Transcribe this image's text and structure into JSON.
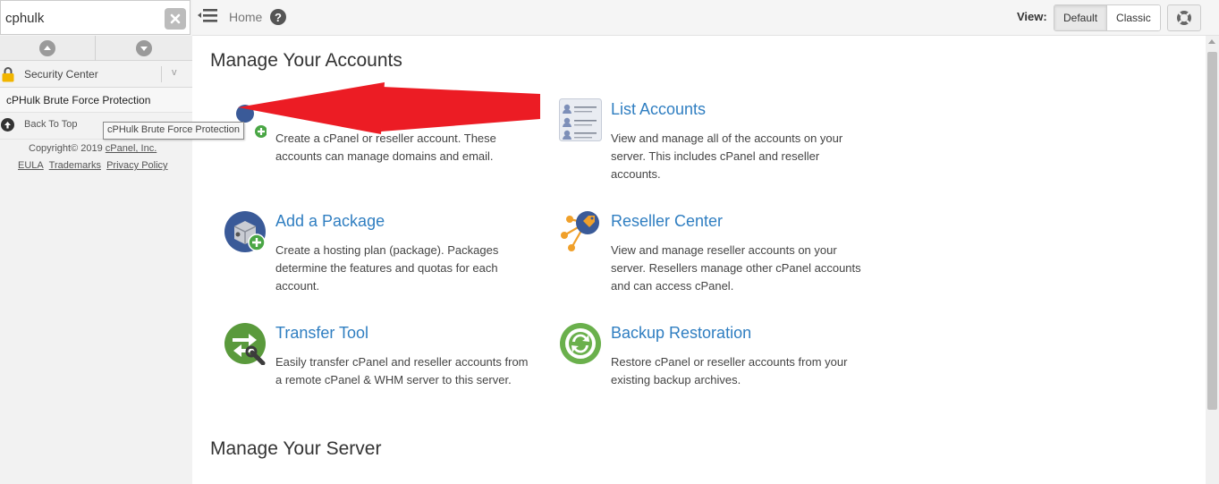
{
  "search": {
    "value": "cphulk"
  },
  "sidebar": {
    "category": "Security Center",
    "category_chevron": "v",
    "result_item": "cPHulk Brute Force Protection",
    "back_to_top": "Back To Top",
    "tooltip": "cPHulk Brute Force Protection",
    "footer": {
      "copyright": "Copyright© 2019",
      "company": "cPanel, Inc.",
      "links": [
        "EULA",
        "Trademarks",
        "Privacy Policy"
      ]
    }
  },
  "topbar": {
    "home": "Home",
    "help": "?",
    "view_label": "View:",
    "view_options": [
      "Default",
      "Classic"
    ],
    "active_view": "Default"
  },
  "main": {
    "section1_title": "Manage Your Accounts",
    "section2_title": "Manage Your Server",
    "features": [
      {
        "title": "",
        "icon": "create-account-icon",
        "desc": "Create a cPanel or reseller account. These accounts can manage domains and email."
      },
      {
        "title": "List Accounts",
        "icon": "list-accounts-icon",
        "desc": "View and manage all of the accounts on your server. This includes cPanel and reseller accounts."
      },
      {
        "title": "Add a Package",
        "icon": "add-package-icon",
        "desc": "Create a hosting plan (package). Packages determine the features and quotas for each account."
      },
      {
        "title": "Reseller Center",
        "icon": "reseller-center-icon",
        "desc": "View and manage reseller accounts on your server. Resellers manage other cPanel accounts and can access cPanel."
      },
      {
        "title": "Transfer Tool",
        "icon": "transfer-tool-icon",
        "desc": "Easily transfer cPanel and reseller accounts from a remote cPanel & WHM server to this server."
      },
      {
        "title": "Backup Restoration",
        "icon": "backup-restoration-icon",
        "desc": "Restore cPanel or reseller accounts from your existing backup archives."
      }
    ]
  },
  "colors": {
    "link": "#2f7ec1",
    "annotation": "#ec1c24",
    "sidebar_bg": "#f2f2f2"
  }
}
